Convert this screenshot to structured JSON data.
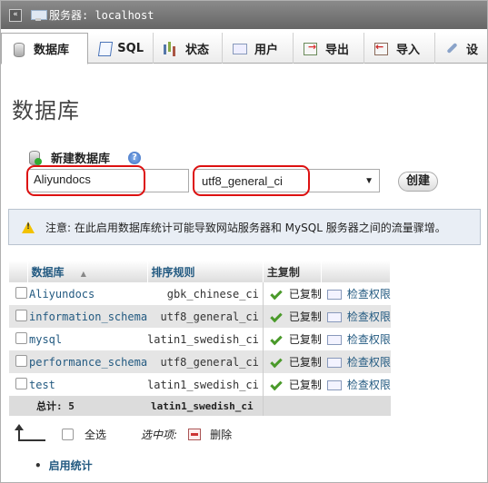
{
  "server": {
    "label": "服务器: localhost",
    "collapse_icon": "collapse-icon"
  },
  "tabs": [
    {
      "label": "数据库",
      "icon": "database-icon",
      "active": true
    },
    {
      "label": "SQL",
      "icon": "sql-icon"
    },
    {
      "label": "状态",
      "icon": "status-icon"
    },
    {
      "label": "用户",
      "icon": "users-icon"
    },
    {
      "label": "导出",
      "icon": "export-icon"
    },
    {
      "label": "导入",
      "icon": "import-icon"
    },
    {
      "label": "设",
      "icon": "settings-icon"
    }
  ],
  "page_title": "数据库",
  "create_db": {
    "label": "新建数据库",
    "name_value": "Aliyundocs",
    "collation_value": "utf8_general_ci",
    "create_button": "创建"
  },
  "notice": "注意: 在此启用数据库统计可能导致网站服务器和 MySQL 服务器之间的流量骤增。",
  "table": {
    "headers": {
      "database": "数据库",
      "sort": "▲",
      "collation": "排序规则",
      "replication": "主复制"
    },
    "rows": [
      {
        "name": "Aliyundocs",
        "collation": "gbk_chinese_ci",
        "replication": "已复制",
        "privs": "检查权限"
      },
      {
        "name": "information_schema",
        "collation": "utf8_general_ci",
        "replication": "已复制",
        "privs": "检查权限"
      },
      {
        "name": "mysql",
        "collation": "latin1_swedish_ci",
        "replication": "已复制",
        "privs": "检查权限"
      },
      {
        "name": "performance_schema",
        "collation": "utf8_general_ci",
        "replication": "已复制",
        "privs": "检查权限"
      },
      {
        "name": "test",
        "collation": "latin1_swedish_ci",
        "replication": "已复制",
        "privs": "检查权限"
      }
    ],
    "total_label": "总计: 5",
    "total_collation": "latin1_swedish_ci"
  },
  "selection": {
    "select_all": "全选",
    "with_selected": "选中项:",
    "delete": "删除"
  },
  "enable_stats": "启用统计",
  "colors": {
    "link": "#235a81",
    "highlight": "#dd1111",
    "notice_bg": "#e9eef5"
  }
}
